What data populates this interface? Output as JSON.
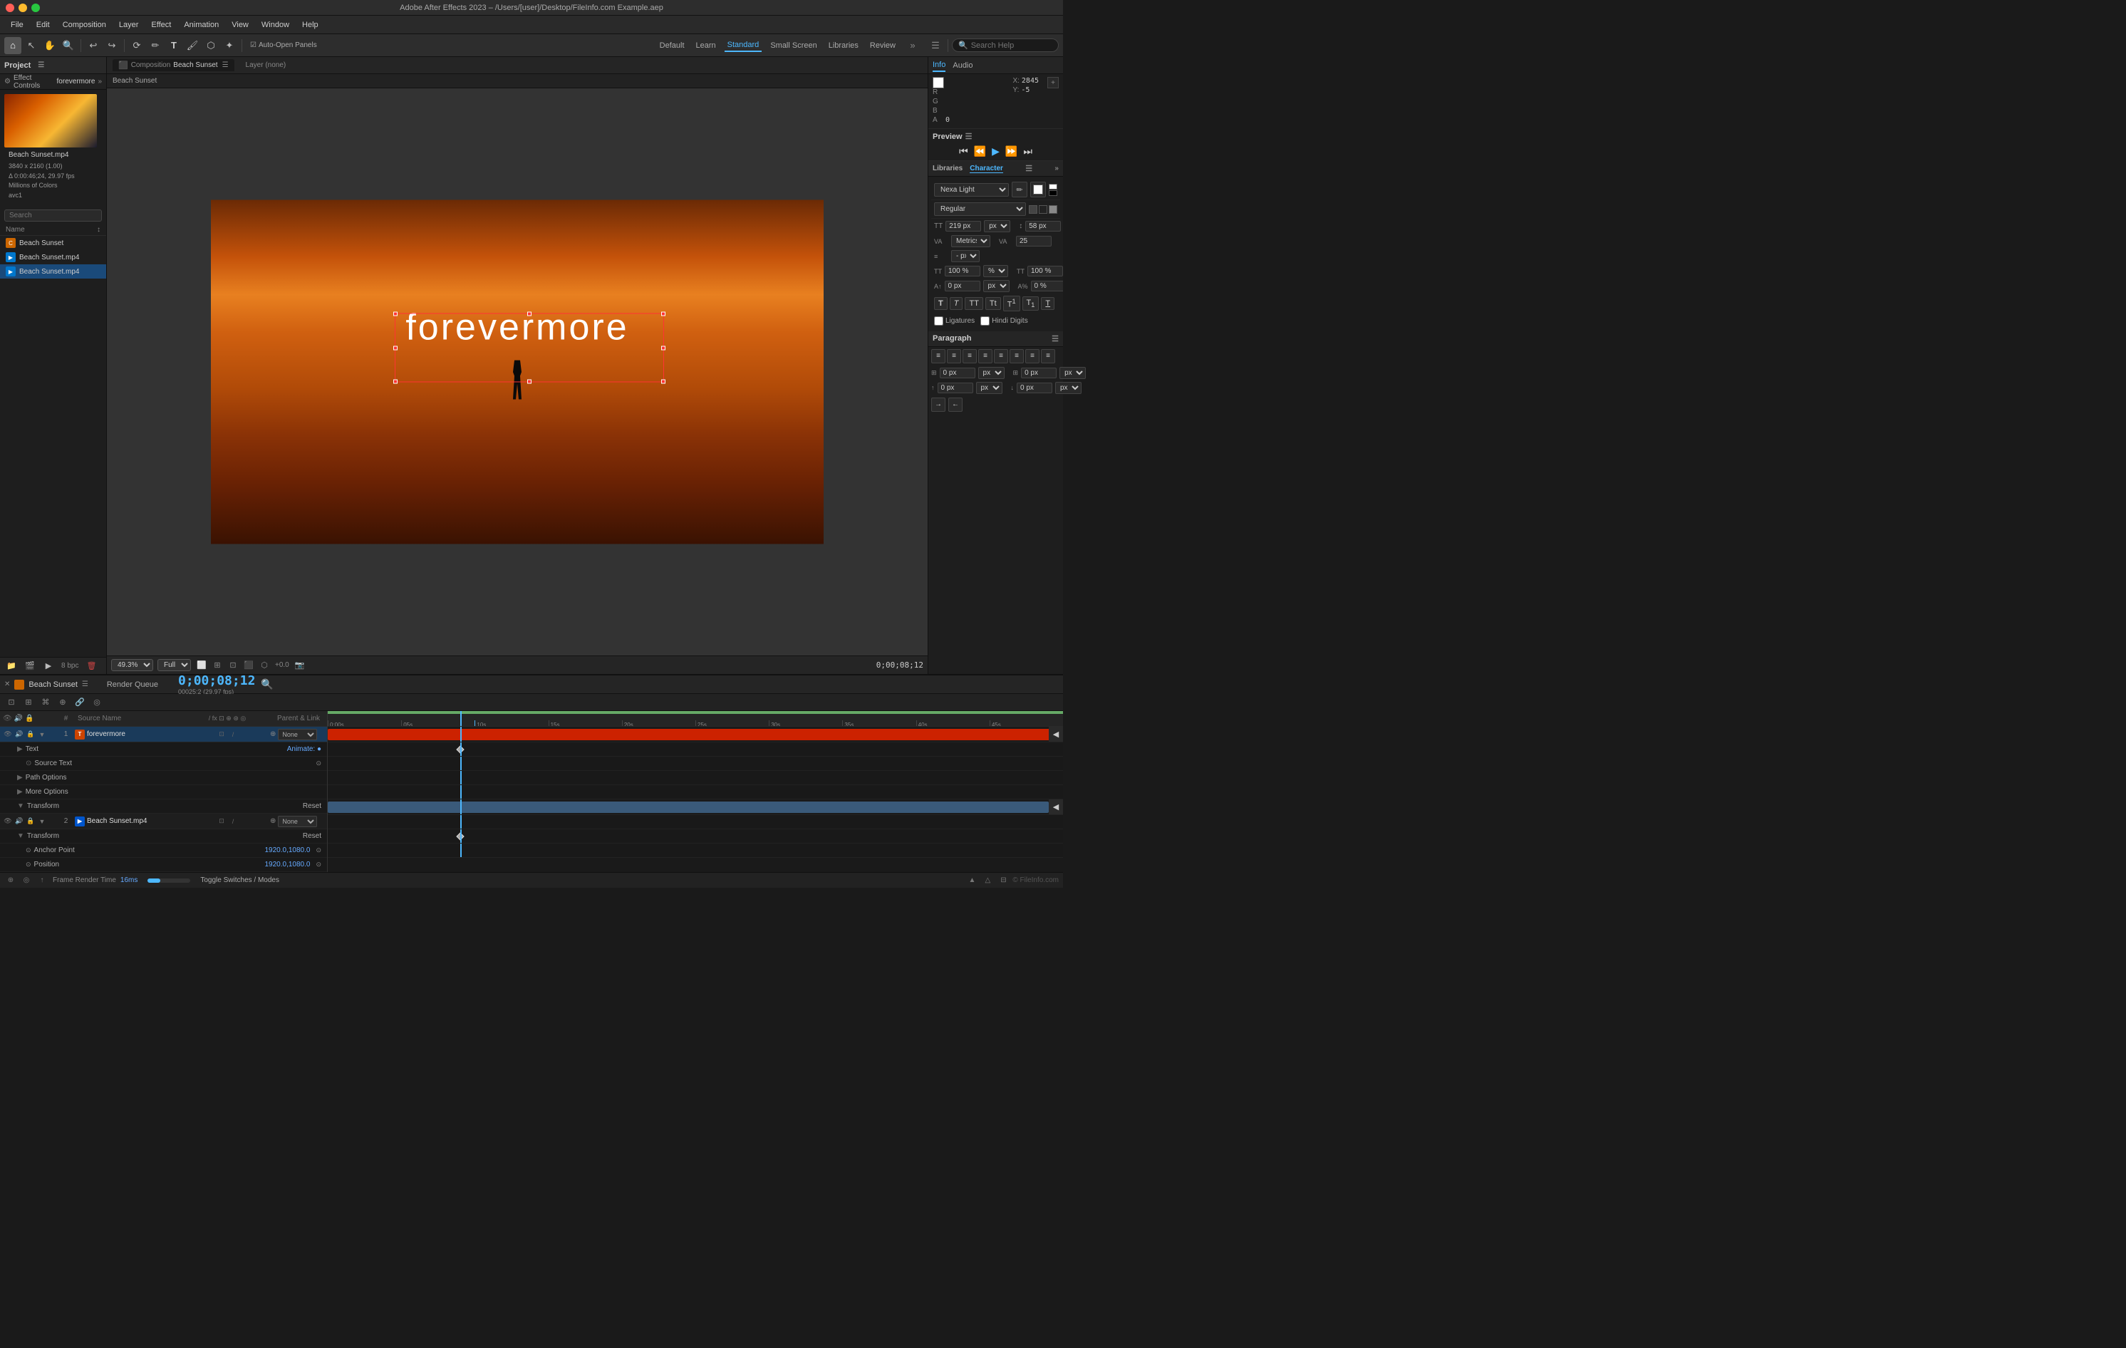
{
  "titlebar": {
    "title": "Adobe After Effects 2023 – /Users/[user]/Desktop/FileInfo.com Example.aep"
  },
  "menu": {
    "items": [
      "File",
      "Edit",
      "Composition",
      "Layer",
      "Effect",
      "Animation",
      "View",
      "Window",
      "Help"
    ]
  },
  "toolbar": {
    "workspace_tabs": [
      "Default",
      "Learn",
      "Standard",
      "Small Screen",
      "Libraries",
      "Review"
    ],
    "active_workspace": "Standard",
    "search_placeholder": "Search Help",
    "auto_open_panels": "Auto-Open Panels"
  },
  "project": {
    "panel_label": "Project",
    "effect_controls_label": "Effect Controls",
    "effect_controls_comp": "forevermore",
    "search_placeholder": "Search",
    "name_col": "Name",
    "thumbnail_file": "Beach Sunset.mp4",
    "thumbnail_info": {
      "resolution": "3840 x 2160 (1.00)",
      "duration": "Δ 0:00:46;24, 29.97 fps",
      "color": "Millions of Colors",
      "codec": "avc1"
    },
    "items": [
      {
        "type": "comp",
        "label": "Beach Sunset"
      },
      {
        "type": "file",
        "label": "Beach Sunset.mp4"
      },
      {
        "type": "file",
        "label": "Beach Sunset.mp4",
        "selected": true
      }
    ]
  },
  "composition": {
    "tab_label": "Composition",
    "comp_name": "Beach Sunset",
    "layer_none": "Layer (none)",
    "text_overlay": "forevermore",
    "zoom": "49.3%",
    "quality": "Full",
    "timecode": "0;00;08;12",
    "watermark": "© FileInfo.com"
  },
  "info_panel": {
    "label": "Info",
    "audio_label": "Audio",
    "r_label": "R",
    "g_label": "G",
    "b_label": "B",
    "a_label": "A",
    "r_value": "",
    "g_value": "",
    "b_value": "",
    "a_value": "0",
    "x_label": "X",
    "y_label": "Y",
    "x_value": "2845",
    "y_value": "-5"
  },
  "preview_panel": {
    "label": "Preview"
  },
  "character_panel": {
    "label": "Character",
    "libraries_tab": "Libraries",
    "font_name": "Nexa Light",
    "font_style": "Regular",
    "font_size": "219 px",
    "leading": "58 px",
    "kerning_label": "Metrics",
    "tracking": "25",
    "vert_scale": "100 %",
    "horiz_scale": "100 %",
    "baseline_shift": "0 px",
    "tsume": "0 %",
    "ligatures": "Ligatures",
    "hindi_digits": "Hindi Digits"
  },
  "paragraph_panel": {
    "label": "Paragraph"
  },
  "timeline": {
    "comp_name": "Beach Sunset",
    "render_queue": "Render Queue",
    "timecode": "0;00;08;12",
    "fps": "00025;2 (29.97 fps)",
    "source_name_col": "Source Name",
    "parent_col": "Parent & Link",
    "layers": [
      {
        "num": "1",
        "type": "text",
        "name": "forevermore",
        "parent": "None",
        "selected": true
      },
      {
        "num": "2",
        "type": "video",
        "name": "Beach Sunset.mp4",
        "parent": "None"
      }
    ],
    "sublayers": [
      {
        "group": "Text",
        "name": "Source Text",
        "value": ""
      },
      {
        "group": "Path Options",
        "name": "Path Options",
        "value": ""
      },
      {
        "group": "More Options",
        "name": "More Options",
        "value": ""
      },
      {
        "group": "Transform",
        "name": "Transform",
        "reset": "Reset"
      }
    ],
    "sublayers2": [
      {
        "name": "Transform",
        "reset": "Reset"
      },
      {
        "name": "Anchor Point",
        "value": "1920.0,1080.0"
      },
      {
        "name": "Position",
        "value": "1920.0,1080.0"
      }
    ],
    "ruler_marks": [
      "0;00s",
      "05s",
      "10s",
      "15s",
      "20s",
      "25s",
      "30s",
      "35s",
      "40s",
      "45s"
    ],
    "frame_render": "Frame Render Time",
    "frame_render_value": "16ms",
    "toggle_switches": "Toggle Switches / Modes",
    "fileinfo_watermark": "© FileInfo.com"
  }
}
